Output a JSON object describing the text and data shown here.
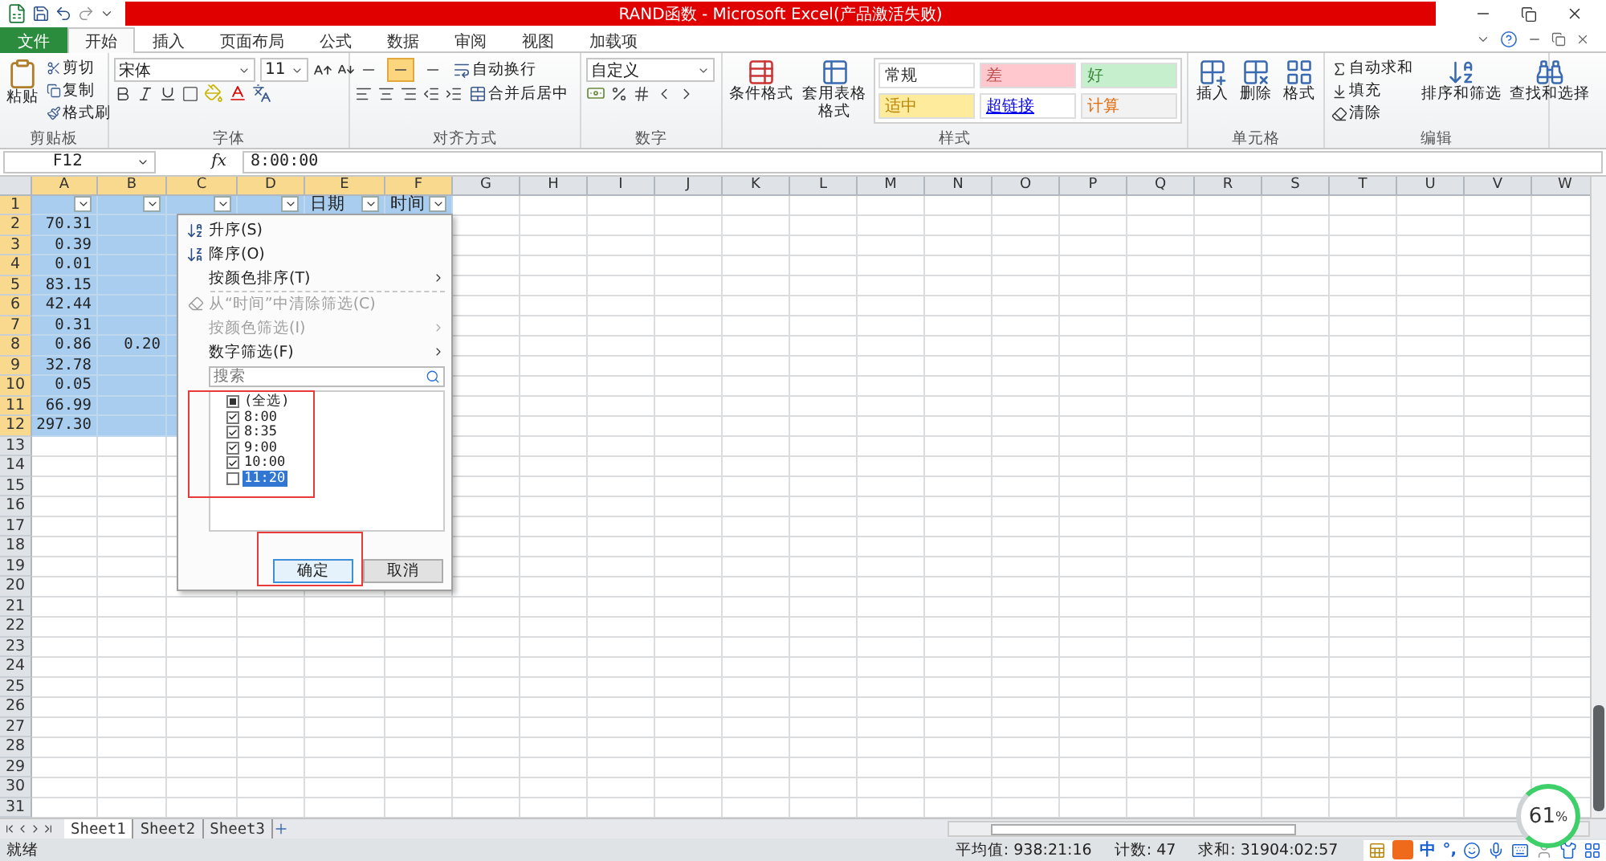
{
  "window": {
    "title": "RAND函数 - Microsoft Excel(产品激活失败)"
  },
  "ribbon_tabs": [
    {
      "label": "文件",
      "kind": "file",
      "selected": false
    },
    {
      "label": "开始",
      "kind": "tab",
      "selected": true
    },
    {
      "label": "插入",
      "kind": "tab",
      "selected": false
    },
    {
      "label": "页面布局",
      "kind": "tab",
      "selected": false
    },
    {
      "label": "公式",
      "kind": "tab",
      "selected": false
    },
    {
      "label": "数据",
      "kind": "tab",
      "selected": false
    },
    {
      "label": "审阅",
      "kind": "tab",
      "selected": false
    },
    {
      "label": "视图",
      "kind": "tab",
      "selected": false
    },
    {
      "label": "加载项",
      "kind": "tab",
      "selected": false
    }
  ],
  "ribbon_groups": [
    {
      "kind": "clipboard",
      "label": "剪贴板",
      "paste": "粘贴",
      "items": [
        "剪切",
        "复制",
        "格式刷"
      ]
    },
    {
      "kind": "font",
      "label": "字体",
      "font_name": "宋体",
      "font_size": "11"
    },
    {
      "kind": "align",
      "label": "对齐方式",
      "wrap": "自动换行",
      "merge": "合并后居中",
      "valign": [
        {
          "selected": false
        },
        {
          "selected": true
        },
        {
          "selected": false
        }
      ]
    },
    {
      "kind": "number",
      "label": "数字",
      "format": "自定义"
    },
    {
      "kind": "styles",
      "label": "样式",
      "buttons": [
        "条件格式",
        "套用表格格式"
      ],
      "cells": [
        {
          "label": "常规",
          "kind": "normal",
          "color": "#ffffff"
        },
        {
          "label": "差",
          "kind": "bad",
          "color": "#ffc7ce"
        },
        {
          "label": "好",
          "kind": "good",
          "color": "#c6efce"
        },
        {
          "label": "适中",
          "kind": "neutral",
          "color": "#ffeb9c"
        },
        {
          "label": "超链接",
          "kind": "hyperlink",
          "color": "#ffffff"
        },
        {
          "label": "计算",
          "kind": "calculation",
          "color": "#f2f2f2"
        }
      ]
    },
    {
      "kind": "cells",
      "label": "单元格",
      "buttons": [
        "插入",
        "删除",
        "格式"
      ]
    },
    {
      "kind": "editing",
      "label": "编辑",
      "items": [
        "自动求和",
        "填充",
        "清除"
      ],
      "buttons": [
        "排序和筛选",
        "查找和选择"
      ]
    }
  ],
  "formula_bar": {
    "name_box": "F12",
    "function_label": "fx",
    "formula": "8:00:00"
  },
  "sheet": {
    "columns": [
      {
        "label": "A",
        "selected": true
      },
      {
        "label": "B",
        "selected": true
      },
      {
        "label": "C",
        "selected": true
      },
      {
        "label": "D",
        "selected": true
      },
      {
        "label": "E",
        "selected": true
      },
      {
        "label": "F",
        "selected": true
      },
      {
        "label": "G",
        "selected": false
      },
      {
        "label": "H",
        "selected": false
      },
      {
        "label": "I",
        "selected": false
      },
      {
        "label": "J",
        "selected": false
      },
      {
        "label": "K",
        "selected": false
      },
      {
        "label": "L",
        "selected": false
      },
      {
        "label": "M",
        "selected": false
      },
      {
        "label": "N",
        "selected": false
      },
      {
        "label": "O",
        "selected": false
      },
      {
        "label": "P",
        "selected": false
      },
      {
        "label": "Q",
        "selected": false
      },
      {
        "label": "R",
        "selected": false
      },
      {
        "label": "S",
        "selected": false
      },
      {
        "label": "T",
        "selected": false
      },
      {
        "label": "U",
        "selected": false
      },
      {
        "label": "V",
        "selected": false
      },
      {
        "label": "W",
        "selected": false
      }
    ],
    "rows": [
      {
        "label": "1",
        "kind": "header",
        "selected": true,
        "cells": {
          "E": "日期",
          "F": "时间"
        }
      },
      {
        "label": "2",
        "kind": "data",
        "selected": true,
        "cells": {
          "A": "70.31"
        }
      },
      {
        "label": "3",
        "kind": "data",
        "selected": true,
        "cells": {
          "A": "0.39"
        }
      },
      {
        "label": "4",
        "kind": "data",
        "selected": true,
        "cells": {
          "A": "0.01"
        }
      },
      {
        "label": "5",
        "kind": "data",
        "selected": true,
        "cells": {
          "A": "83.15"
        }
      },
      {
        "label": "6",
        "kind": "data",
        "selected": true,
        "cells": {
          "A": "42.44"
        }
      },
      {
        "label": "7",
        "kind": "data",
        "selected": true,
        "cells": {
          "A": "0.31"
        }
      },
      {
        "label": "8",
        "kind": "data",
        "selected": true,
        "cells": {
          "A": "0.86",
          "B": "0.20"
        }
      },
      {
        "label": "9",
        "kind": "data",
        "selected": true,
        "cells": {
          "A": "32.78"
        }
      },
      {
        "label": "10",
        "kind": "data",
        "selected": true,
        "cells": {
          "A": "0.05"
        }
      },
      {
        "label": "11",
        "kind": "data",
        "selected": true,
        "cells": {
          "A": "66.99"
        }
      },
      {
        "label": "12",
        "kind": "data",
        "selected": true,
        "cells": {
          "A": "297.30"
        }
      },
      {
        "label": "13",
        "kind": "data",
        "selected": false
      },
      {
        "label": "14",
        "kind": "data",
        "selected": false
      },
      {
        "label": "15",
        "kind": "data",
        "selected": false
      },
      {
        "label": "16",
        "kind": "data",
        "selected": false
      },
      {
        "label": "17",
        "kind": "data",
        "selected": false
      },
      {
        "label": "18",
        "kind": "data",
        "selected": false
      },
      {
        "label": "19",
        "kind": "data",
        "selected": false
      },
      {
        "label": "20",
        "kind": "data",
        "selected": false
      },
      {
        "label": "21",
        "kind": "data",
        "selected": false
      },
      {
        "label": "22",
        "kind": "data",
        "selected": false
      },
      {
        "label": "23",
        "kind": "data",
        "selected": false
      },
      {
        "label": "24",
        "kind": "data",
        "selected": false
      },
      {
        "label": "25",
        "kind": "data",
        "selected": false
      },
      {
        "label": "26",
        "kind": "data",
        "selected": false
      },
      {
        "label": "27",
        "kind": "data",
        "selected": false
      },
      {
        "label": "28",
        "kind": "data",
        "selected": false
      },
      {
        "label": "29",
        "kind": "data",
        "selected": false
      },
      {
        "label": "30",
        "kind": "data",
        "selected": false
      },
      {
        "label": "31",
        "kind": "data",
        "selected": false
      }
    ]
  },
  "filter_menu": {
    "items": [
      {
        "kind": "sort_asc",
        "label": "升序(S)",
        "disabled": false,
        "submenu": false
      },
      {
        "kind": "sort_desc",
        "label": "降序(O)",
        "disabled": false,
        "submenu": false
      },
      {
        "kind": "plain",
        "label": "按颜色排序(T)",
        "disabled": false,
        "submenu": true
      },
      {
        "kind": "separator"
      },
      {
        "kind": "clear",
        "label": "从“时间”中清除筛选(C)",
        "disabled": true,
        "submenu": false
      },
      {
        "kind": "plain",
        "label": "按颜色筛选(I)",
        "disabled": true,
        "submenu": true
      },
      {
        "kind": "plain",
        "label": "数字筛选(F)",
        "disabled": false,
        "submenu": true
      }
    ],
    "search": {
      "placeholder": "搜索"
    },
    "values": [
      {
        "label": "(全选)",
        "partial": true,
        "selected": false
      },
      {
        "label": "8:00",
        "checked": true,
        "selected": false
      },
      {
        "label": "8:35",
        "checked": true,
        "selected": false
      },
      {
        "label": "9:00",
        "checked": true,
        "selected": false
      },
      {
        "label": "10:00",
        "checked": true,
        "selected": false
      },
      {
        "label": "11:20",
        "checked": false,
        "selected": true
      }
    ],
    "buttons": [
      {
        "label": "确定",
        "focused": true
      },
      {
        "label": "取消",
        "focused": false
      }
    ]
  },
  "sheet_tabs": [
    {
      "label": "Sheet1",
      "selected": true
    },
    {
      "label": "Sheet2",
      "selected": false
    },
    {
      "label": "Sheet3",
      "selected": false
    }
  ],
  "status_bar": {
    "ready": "就绪",
    "average": "平均值: 938:21:16",
    "count": "计数: 47",
    "sum": "求和: 31904:02:57"
  },
  "ime_bar": {
    "mode": "中",
    "punctuation": "°,"
  },
  "meter": {
    "reading": "61",
    "unit": "%"
  }
}
